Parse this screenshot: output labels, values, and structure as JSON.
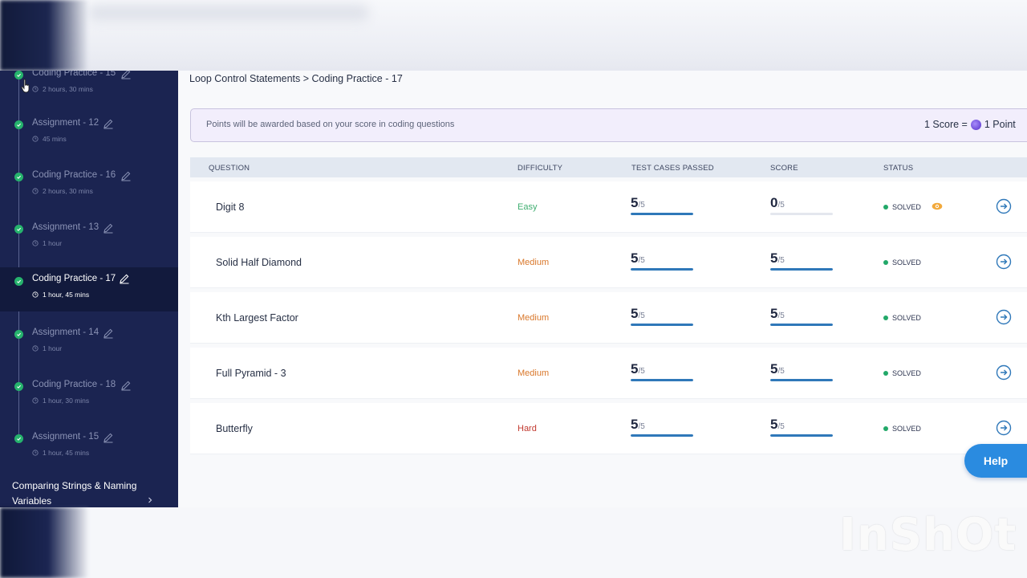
{
  "sidebar": {
    "items": [
      {
        "title": "Coding Practice - 15",
        "duration": "2 hours, 30 mins",
        "active": false
      },
      {
        "title": "Assignment - 12",
        "duration": "45 mins",
        "active": false
      },
      {
        "title": "Coding Practice - 16",
        "duration": "2 hours, 30 mins",
        "active": false
      },
      {
        "title": "Assignment - 13",
        "duration": "1 hour",
        "active": false
      },
      {
        "title": "Coding Practice - 17",
        "duration": "1 hour, 45 mins",
        "active": true
      },
      {
        "title": "Assignment - 14",
        "duration": "1 hour",
        "active": false
      },
      {
        "title": "Coding Practice - 18",
        "duration": "1 hour, 30 mins",
        "active": false
      },
      {
        "title": "Assignment - 15",
        "duration": "1 hour, 45 mins",
        "active": false
      }
    ],
    "next_section": "Comparing Strings & Naming Variables"
  },
  "breadcrumb": "Loop Control Statements > Coding Practice - 17",
  "notice": {
    "text": "Points will be awarded based on your score in coding questions",
    "score_prefix": "1 Score =",
    "score_suffix": "1 Point"
  },
  "table": {
    "headers": {
      "question": "QUESTION",
      "difficulty": "DIFFICULTY",
      "test_cases": "TEST CASES PASSED",
      "score": "SCORE",
      "status": "STATUS"
    },
    "rows": [
      {
        "question": "Digit 8",
        "difficulty": "Easy",
        "difficulty_color": "#3fae70",
        "tests_passed": "5",
        "tests_total": "/5",
        "score": "0",
        "score_total": "/5",
        "status": "SOLVED",
        "has_eye": true
      },
      {
        "question": "Solid Half Diamond",
        "difficulty": "Medium",
        "difficulty_color": "#d9772a",
        "tests_passed": "5",
        "tests_total": "/5",
        "score": "5",
        "score_total": "/5",
        "status": "SOLVED",
        "has_eye": false
      },
      {
        "question": "Kth Largest Factor",
        "difficulty": "Medium",
        "difficulty_color": "#d9772a",
        "tests_passed": "5",
        "tests_total": "/5",
        "score": "5",
        "score_total": "/5",
        "status": "SOLVED",
        "has_eye": false
      },
      {
        "question": "Full Pyramid - 3",
        "difficulty": "Medium",
        "difficulty_color": "#d9772a",
        "tests_passed": "5",
        "tests_total": "/5",
        "score": "5",
        "score_total": "/5",
        "status": "SOLVED",
        "has_eye": false
      },
      {
        "question": "Butterfly",
        "difficulty": "Hard",
        "difficulty_color": "#c2392f",
        "tests_passed": "5",
        "tests_total": "/5",
        "score": "5",
        "score_total": "/5",
        "status": "SOLVED",
        "has_eye": false
      }
    ]
  },
  "help_label": "Help",
  "watermark": "InShOt"
}
